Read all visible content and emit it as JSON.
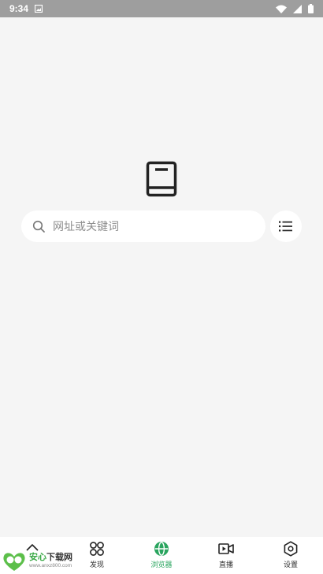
{
  "status_bar": {
    "time": "9:34"
  },
  "search": {
    "placeholder": "网址或关键词"
  },
  "bottom_nav": {
    "items": [
      {
        "label": "",
        "icon": "home-up-icon"
      },
      {
        "label": "发现",
        "icon": "discover-grid-icon"
      },
      {
        "label": "浏览器",
        "icon": "globe-icon",
        "active": true
      },
      {
        "label": "直播",
        "icon": "video-icon"
      },
      {
        "label": "设置",
        "icon": "settings-hex-icon"
      }
    ]
  },
  "watermark": {
    "title_green": "安心",
    "title_dark": "下载网",
    "url": "www.anxz800.com"
  },
  "colors": {
    "accent": "#2aa55f",
    "background": "#f5f5f5",
    "status_bar": "#9e9e9e"
  }
}
